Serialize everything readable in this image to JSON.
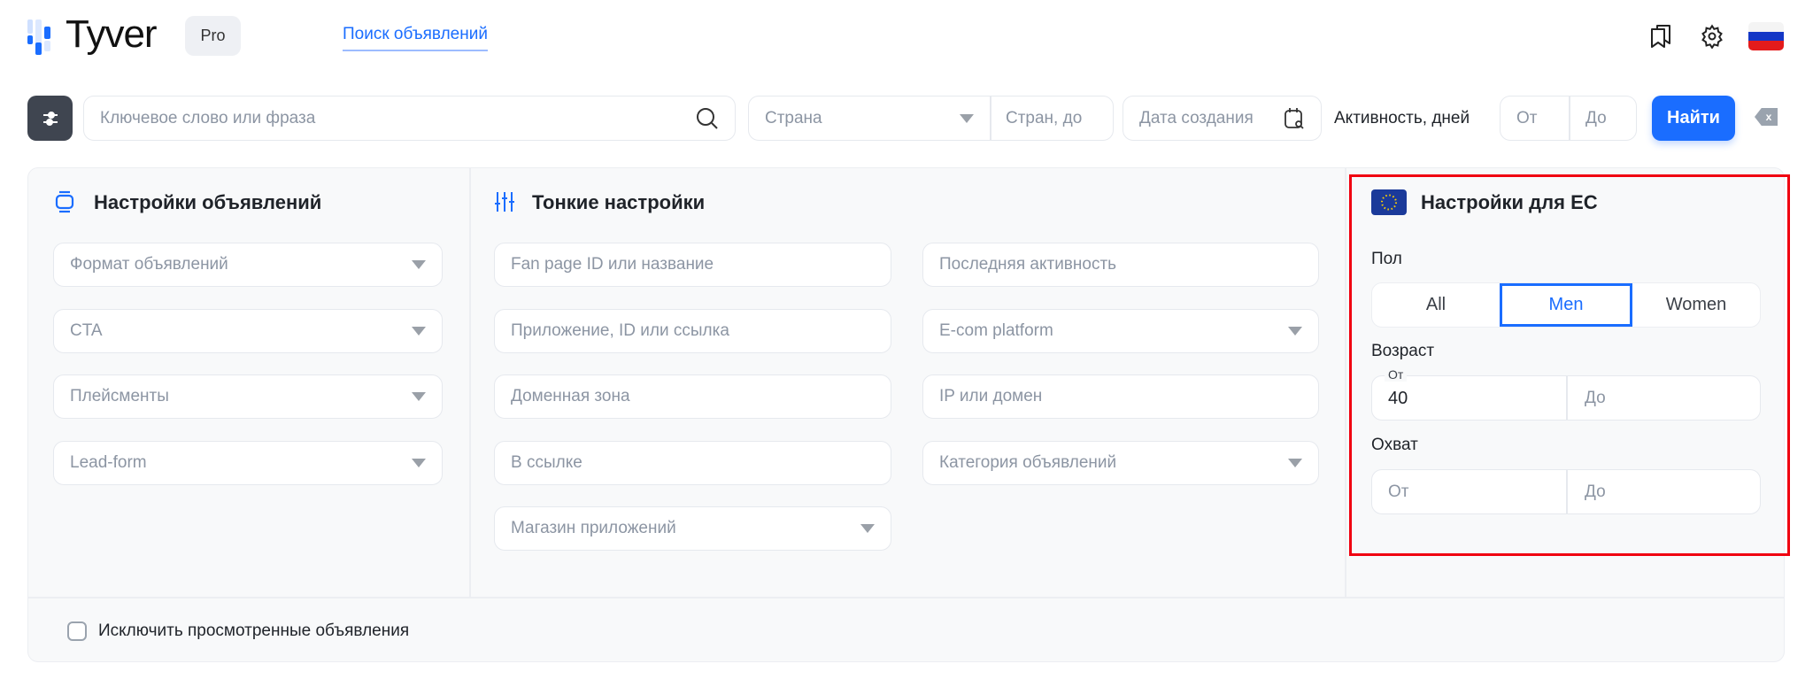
{
  "header": {
    "logo_text": "Tyver",
    "plan_badge": "Pro",
    "nav_link": "Поиск объявлений",
    "icons": [
      "bookmarks-icon",
      "gear-icon",
      "russia-flag-icon"
    ]
  },
  "search_bar": {
    "keyword_placeholder": "Ключевое слово или фраза",
    "country_placeholder": "Страна",
    "country_to_placeholder": "Стран, до",
    "date_placeholder": "Дата создания",
    "activity_label": "Активность, дней",
    "activity_from": "От",
    "activity_to": "До",
    "find_button": "Найти",
    "clear_label": "x"
  },
  "ad_settings": {
    "title": "Настройки объявлений",
    "fields": [
      "Формат объявлений",
      "CTA",
      "Плейсменты",
      "Lead-form"
    ]
  },
  "fine_settings": {
    "title": "Тонкие настройки",
    "col1": [
      {
        "label": "Fan page ID или название",
        "dropdown": false
      },
      {
        "label": "Приложение, ID или ссылка",
        "dropdown": false
      },
      {
        "label": "Доменная зона",
        "dropdown": false
      },
      {
        "label": "В ссылке",
        "dropdown": false
      },
      {
        "label": "Магазин приложений",
        "dropdown": true
      }
    ],
    "col2": [
      {
        "label": "Последняя активность",
        "dropdown": false
      },
      {
        "label": "E-com platform",
        "dropdown": true
      },
      {
        "label": "IP или домен",
        "dropdown": false
      },
      {
        "label": "Категория объявлений",
        "dropdown": true
      }
    ]
  },
  "eu_settings": {
    "title": "Настройки для ЕС",
    "gender_label": "Пол",
    "gender_options": [
      "All",
      "Men",
      "Women"
    ],
    "gender_selected": "Men",
    "age_label": "Возраст",
    "age_from_label": "От",
    "age_from_value": "40",
    "age_to_placeholder": "До",
    "reach_label": "Охват",
    "reach_from_placeholder": "От",
    "reach_to_placeholder": "До"
  },
  "footer": {
    "exclude_viewed": "Исключить просмотренные объявления",
    "exclude_viewed_checked": false
  },
  "colors": {
    "accent": "#1a6dff",
    "highlight": "#f00010"
  }
}
